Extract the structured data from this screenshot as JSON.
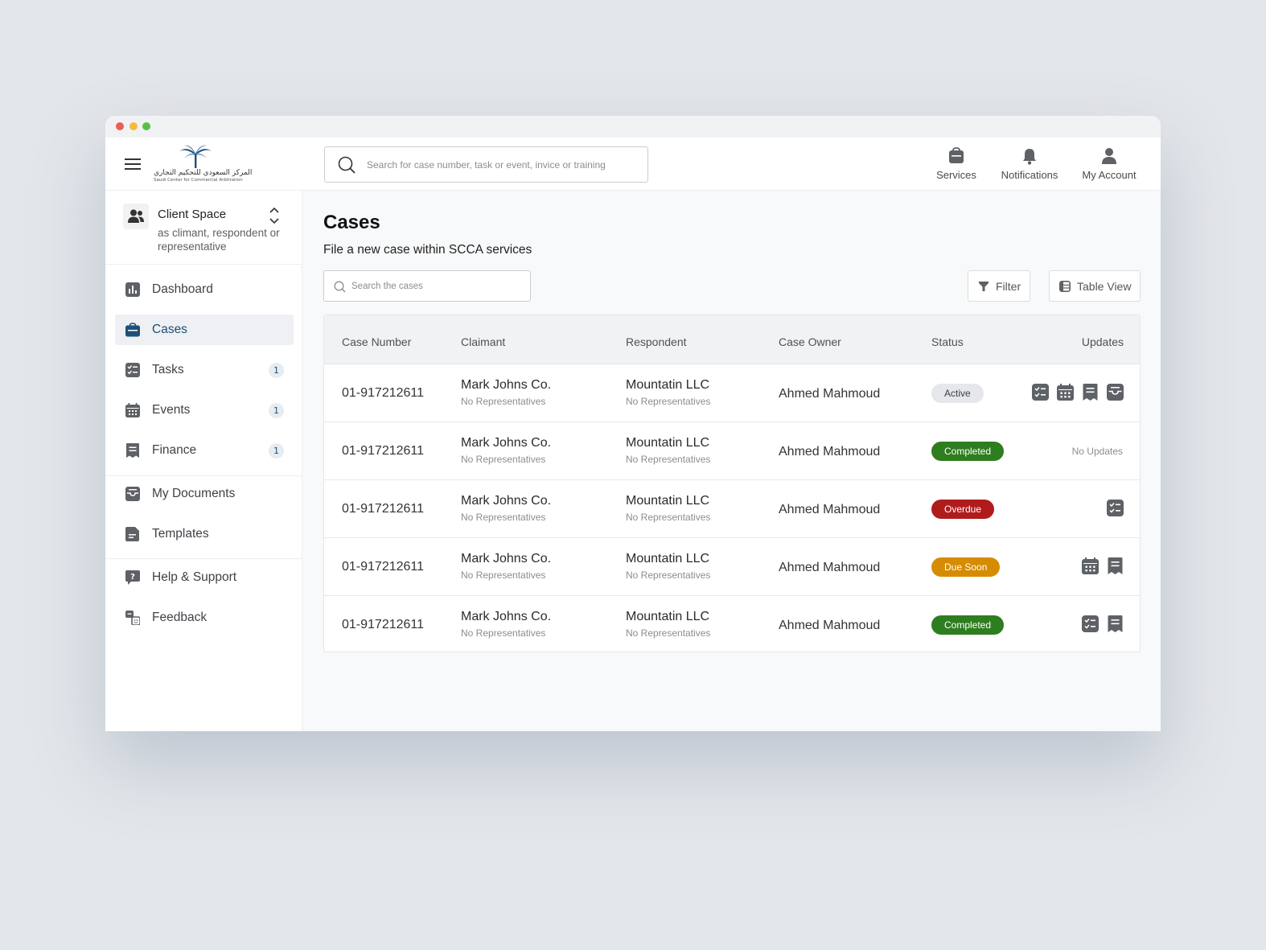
{
  "colors": {
    "brand": "#1d4f7a",
    "icon_gray": "#5e6166",
    "active_bg": "#e5e7eb",
    "completed": "#2e7d1f",
    "overdue": "#b01c1c",
    "due_soon": "#d68c00"
  },
  "logo": {
    "arabic": "المركز السعودي للتحكيم التجاري",
    "english": "Saudi Center for Commercial Arbitration"
  },
  "header": {
    "search_placeholder": "Search for case number, task or event, invice or training",
    "actions": [
      {
        "label": "Services",
        "icon": "briefcase-icon"
      },
      {
        "label": "Notifications",
        "icon": "bell-icon"
      },
      {
        "label": "My Account",
        "icon": "user-icon"
      }
    ]
  },
  "sidebar": {
    "client_space": {
      "title": "Client Space",
      "subtitle": "as climant, respondent or representative"
    },
    "items": [
      {
        "label": "Dashboard",
        "icon": "chart-icon"
      },
      {
        "label": "Cases",
        "icon": "briefcase-icon",
        "active": true
      },
      {
        "label": "Tasks",
        "icon": "checklist-icon",
        "badge": "1"
      },
      {
        "label": "Events",
        "icon": "calendar-icon",
        "badge": "1"
      },
      {
        "label": "Finance",
        "icon": "receipt-icon",
        "badge": "1"
      },
      {
        "label": "My Documents",
        "icon": "documents-icon"
      },
      {
        "label": "Templates",
        "icon": "template-icon"
      },
      {
        "label": "Help & Support",
        "icon": "help-icon"
      },
      {
        "label": "Feedback",
        "icon": "feedback-icon"
      }
    ]
  },
  "page": {
    "title": "Cases",
    "subtitle": "File a new case within SCCA services",
    "search_placeholder": "Search the cases",
    "filter_label": "Filter",
    "view_label": "Table View"
  },
  "table": {
    "columns": [
      "Case Number",
      "Claimant",
      "Respondent",
      "Case Owner",
      "Status",
      "Updates"
    ],
    "rows": [
      {
        "case_number": "01-917212611",
        "claimant": "Mark Johns Co.",
        "claimant_rep": "No Representatives",
        "respondent": "Mountatin LLC",
        "respondent_rep": "No Representatives",
        "owner": "Ahmed Mahmoud",
        "status": "Active",
        "status_kind": "active",
        "updates": [
          "checklist-icon",
          "calendar-icon",
          "receipt-icon",
          "documents-icon"
        ]
      },
      {
        "case_number": "01-917212611",
        "claimant": "Mark Johns Co.",
        "claimant_rep": "No Representatives",
        "respondent": "Mountatin LLC",
        "respondent_rep": "No Representatives",
        "owner": "Ahmed Mahmoud",
        "status": "Completed",
        "status_kind": "completed",
        "updates": [],
        "updates_text": "No Updates"
      },
      {
        "case_number": "01-917212611",
        "claimant": "Mark Johns Co.",
        "claimant_rep": "No Representatives",
        "respondent": "Mountatin LLC",
        "respondent_rep": "No Representatives",
        "owner": "Ahmed Mahmoud",
        "status": "Overdue",
        "status_kind": "overdue",
        "updates": [
          "checklist-icon"
        ]
      },
      {
        "case_number": "01-917212611",
        "claimant": "Mark Johns Co.",
        "claimant_rep": "No Representatives",
        "respondent": "Mountatin LLC",
        "respondent_rep": "No Representatives",
        "owner": "Ahmed Mahmoud",
        "status": "Due Soon",
        "status_kind": "due_soon",
        "updates": [
          "calendar-icon",
          "receipt-icon"
        ]
      },
      {
        "case_number": "01-917212611",
        "claimant": "Mark Johns Co.",
        "claimant_rep": "No Representatives",
        "respondent": "Mountatin LLC",
        "respondent_rep": "No Representatives",
        "owner": "Ahmed Mahmoud",
        "status": "Completed",
        "status_kind": "completed",
        "updates": [
          "checklist-icon",
          "receipt-icon"
        ]
      }
    ]
  }
}
